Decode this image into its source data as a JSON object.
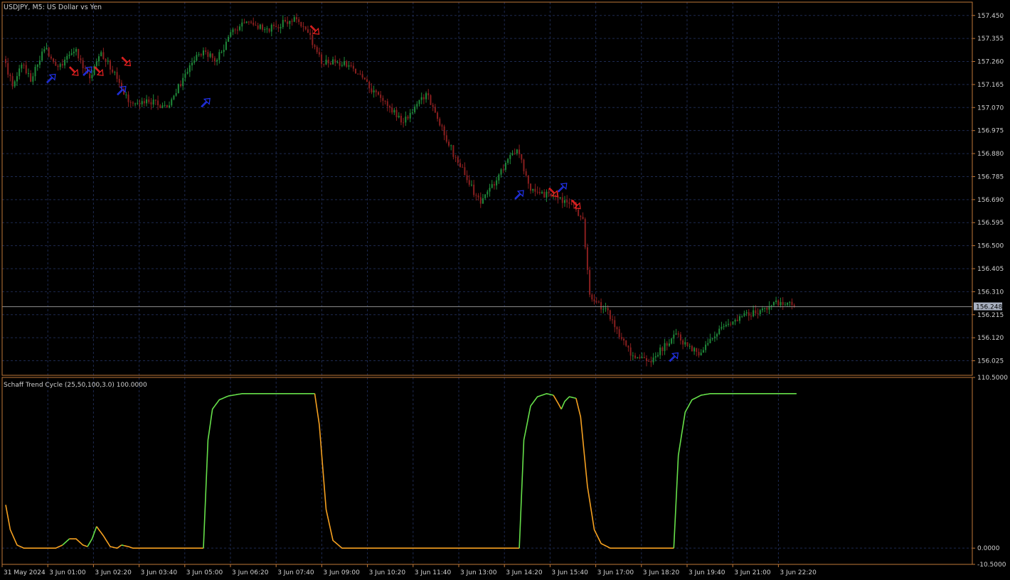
{
  "window": {
    "title": "USDJPY, M5:  US Dollar vs Yen"
  },
  "price_axis": {
    "ticks": [
      "157.450",
      "157.355",
      "157.260",
      "157.165",
      "157.070",
      "156.975",
      "156.880",
      "156.785",
      "156.690",
      "156.595",
      "156.500",
      "156.405",
      "156.310",
      "156.215",
      "156.120",
      "156.025"
    ],
    "current_price": "156.248"
  },
  "indicator": {
    "label": "Schaff Trend Cycle (25,50,100,3.0) 100.0000",
    "ticks": [
      "110.5000",
      "0.0000",
      "-10.5000"
    ]
  },
  "time_axis": {
    "labels": [
      "31 May 2024",
      "3 Jun 01:00",
      "3 Jun 02:20",
      "3 Jun 03:40",
      "3 Jun 05:00",
      "3 Jun 06:20",
      "3 Jun 07:40",
      "3 Jun 09:00",
      "3 Jun 10:20",
      "3 Jun 11:40",
      "3 Jun 13:00",
      "3 Jun 14:20",
      "3 Jun 15:40",
      "3 Jun 17:00",
      "3 Jun 18:20",
      "3 Jun 19:40",
      "3 Jun 21:00",
      "3 Jun 22:20"
    ]
  },
  "colors": {
    "background": "#000000",
    "frame": "#c07838",
    "grid": "#1e2a50",
    "bull_candle": "#1f8a3a",
    "bear_candle": "#8a1f1f",
    "stc_up": "#66e04a",
    "stc_down": "#f5a020",
    "buy_arrow": "#2233ee",
    "sell_arrow": "#ee2222",
    "price_line": "#8a8a8a",
    "price_tag_bg": "#a8b0c0"
  },
  "chart_data": {
    "type": "candlestick_with_oscillator",
    "symbol": "USDJPY",
    "timeframe": "M5",
    "price_ylim": [
      155.965,
      157.505
    ],
    "price_path": [
      {
        "t": 0,
        "p": 157.27
      },
      {
        "t": 4,
        "p": 157.16
      },
      {
        "t": 8,
        "p": 157.25
      },
      {
        "t": 12,
        "p": 157.19
      },
      {
        "t": 18,
        "p": 157.32
      },
      {
        "t": 24,
        "p": 157.24
      },
      {
        "t": 32,
        "p": 157.3
      },
      {
        "t": 38,
        "p": 157.19
      },
      {
        "t": 43,
        "p": 157.3
      },
      {
        "t": 48,
        "p": 157.22
      },
      {
        "t": 56,
        "p": 157.08
      },
      {
        "t": 64,
        "p": 157.1
      },
      {
        "t": 72,
        "p": 157.07
      },
      {
        "t": 76,
        "p": 157.14
      },
      {
        "t": 86,
        "p": 157.3
      },
      {
        "t": 94,
        "p": 157.27
      },
      {
        "t": 100,
        "p": 157.37
      },
      {
        "t": 106,
        "p": 157.43
      },
      {
        "t": 116,
        "p": 157.39
      },
      {
        "t": 128,
        "p": 157.44
      },
      {
        "t": 134,
        "p": 157.38
      },
      {
        "t": 140,
        "p": 157.26
      },
      {
        "t": 152,
        "p": 157.25
      },
      {
        "t": 164,
        "p": 157.12
      },
      {
        "t": 176,
        "p": 157.01
      },
      {
        "t": 186,
        "p": 157.13
      },
      {
        "t": 198,
        "p": 156.88
      },
      {
        "t": 210,
        "p": 156.67
      },
      {
        "t": 220,
        "p": 156.82
      },
      {
        "t": 226,
        "p": 156.9
      },
      {
        "t": 232,
        "p": 156.73
      },
      {
        "t": 242,
        "p": 156.7
      },
      {
        "t": 250,
        "p": 156.68
      },
      {
        "t": 255,
        "p": 156.6
      },
      {
        "t": 258,
        "p": 156.3
      },
      {
        "t": 266,
        "p": 156.22
      },
      {
        "t": 276,
        "p": 156.05
      },
      {
        "t": 285,
        "p": 156.03
      },
      {
        "t": 296,
        "p": 156.13
      },
      {
        "t": 306,
        "p": 156.05
      },
      {
        "t": 315,
        "p": 156.15
      },
      {
        "t": 322,
        "p": 156.2
      },
      {
        "t": 332,
        "p": 156.23
      },
      {
        "t": 342,
        "p": 156.27
      },
      {
        "t": 347,
        "p": 156.25
      }
    ],
    "current_price": 156.248,
    "signals": [
      {
        "t": 20,
        "type": "buy",
        "price": 157.19
      },
      {
        "t": 30,
        "type": "sell",
        "price": 157.22
      },
      {
        "t": 36,
        "type": "buy",
        "price": 157.22
      },
      {
        "t": 41,
        "type": "sell",
        "price": 157.22
      },
      {
        "t": 51,
        "type": "buy",
        "price": 157.14
      },
      {
        "t": 53,
        "type": "sell",
        "price": 157.26
      },
      {
        "t": 88,
        "type": "buy",
        "price": 157.09
      },
      {
        "t": 136,
        "type": "sell",
        "price": 157.39
      },
      {
        "t": 226,
        "type": "buy",
        "price": 156.71
      },
      {
        "t": 241,
        "type": "sell",
        "price": 156.72
      },
      {
        "t": 245,
        "type": "buy",
        "price": 156.74
      },
      {
        "t": 251,
        "type": "sell",
        "price": 156.67
      },
      {
        "t": 294,
        "type": "buy",
        "price": 156.04
      }
    ],
    "stc_ylim": [
      -10.5,
      110.5
    ],
    "stc_path": [
      {
        "t": 0,
        "v": 28
      },
      {
        "t": 2,
        "v": 12
      },
      {
        "t": 5,
        "v": 2
      },
      {
        "t": 8,
        "v": 0
      },
      {
        "t": 22,
        "v": 0
      },
      {
        "t": 25,
        "v": 2
      },
      {
        "t": 28,
        "v": 6
      },
      {
        "t": 31,
        "v": 6
      },
      {
        "t": 34,
        "v": 2
      },
      {
        "t": 36,
        "v": 1
      },
      {
        "t": 38,
        "v": 6
      },
      {
        "t": 40,
        "v": 14
      },
      {
        "t": 43,
        "v": 8
      },
      {
        "t": 46,
        "v": 1
      },
      {
        "t": 49,
        "v": 0
      },
      {
        "t": 51,
        "v": 2
      },
      {
        "t": 54,
        "v": 1
      },
      {
        "t": 56,
        "v": 0
      },
      {
        "t": 87,
        "v": 0
      },
      {
        "t": 89,
        "v": 70
      },
      {
        "t": 91,
        "v": 90
      },
      {
        "t": 94,
        "v": 96
      },
      {
        "t": 98,
        "v": 98.5
      },
      {
        "t": 104,
        "v": 100
      },
      {
        "t": 136,
        "v": 100
      },
      {
        "t": 138,
        "v": 80
      },
      {
        "t": 141,
        "v": 25
      },
      {
        "t": 144,
        "v": 5
      },
      {
        "t": 148,
        "v": 0
      },
      {
        "t": 226,
        "v": 0
      },
      {
        "t": 228,
        "v": 70
      },
      {
        "t": 231,
        "v": 92
      },
      {
        "t": 234,
        "v": 98
      },
      {
        "t": 238,
        "v": 100
      },
      {
        "t": 241,
        "v": 99
      },
      {
        "t": 243,
        "v": 94
      },
      {
        "t": 244.5,
        "v": 90
      },
      {
        "t": 246,
        "v": 95
      },
      {
        "t": 248,
        "v": 98
      },
      {
        "t": 251,
        "v": 97
      },
      {
        "t": 253,
        "v": 85
      },
      {
        "t": 256,
        "v": 40
      },
      {
        "t": 259,
        "v": 12
      },
      {
        "t": 262,
        "v": 3
      },
      {
        "t": 266,
        "v": 0
      },
      {
        "t": 294,
        "v": 0
      },
      {
        "t": 296,
        "v": 60
      },
      {
        "t": 299,
        "v": 88
      },
      {
        "t": 302,
        "v": 96
      },
      {
        "t": 306,
        "v": 99
      },
      {
        "t": 310,
        "v": 100
      },
      {
        "t": 348,
        "v": 100
      }
    ],
    "stc_color_segments": [
      {
        "from": 0,
        "to": 25,
        "dir": "down"
      },
      {
        "from": 25,
        "to": 28,
        "dir": "up"
      },
      {
        "from": 28,
        "to": 36,
        "dir": "down"
      },
      {
        "from": 36,
        "to": 40,
        "dir": "up"
      },
      {
        "from": 40,
        "to": 51,
        "dir": "down"
      },
      {
        "from": 51,
        "to": 52,
        "dir": "up"
      },
      {
        "from": 52,
        "to": 87,
        "dir": "down"
      },
      {
        "from": 87,
        "to": 136,
        "dir": "up"
      },
      {
        "from": 136,
        "to": 226,
        "dir": "down"
      },
      {
        "from": 226,
        "to": 241,
        "dir": "up"
      },
      {
        "from": 241,
        "to": 244.5,
        "dir": "down"
      },
      {
        "from": 244.5,
        "to": 251,
        "dir": "up"
      },
      {
        "from": 251,
        "to": 294,
        "dir": "down"
      },
      {
        "from": 294,
        "to": 348,
        "dir": "up"
      }
    ]
  }
}
